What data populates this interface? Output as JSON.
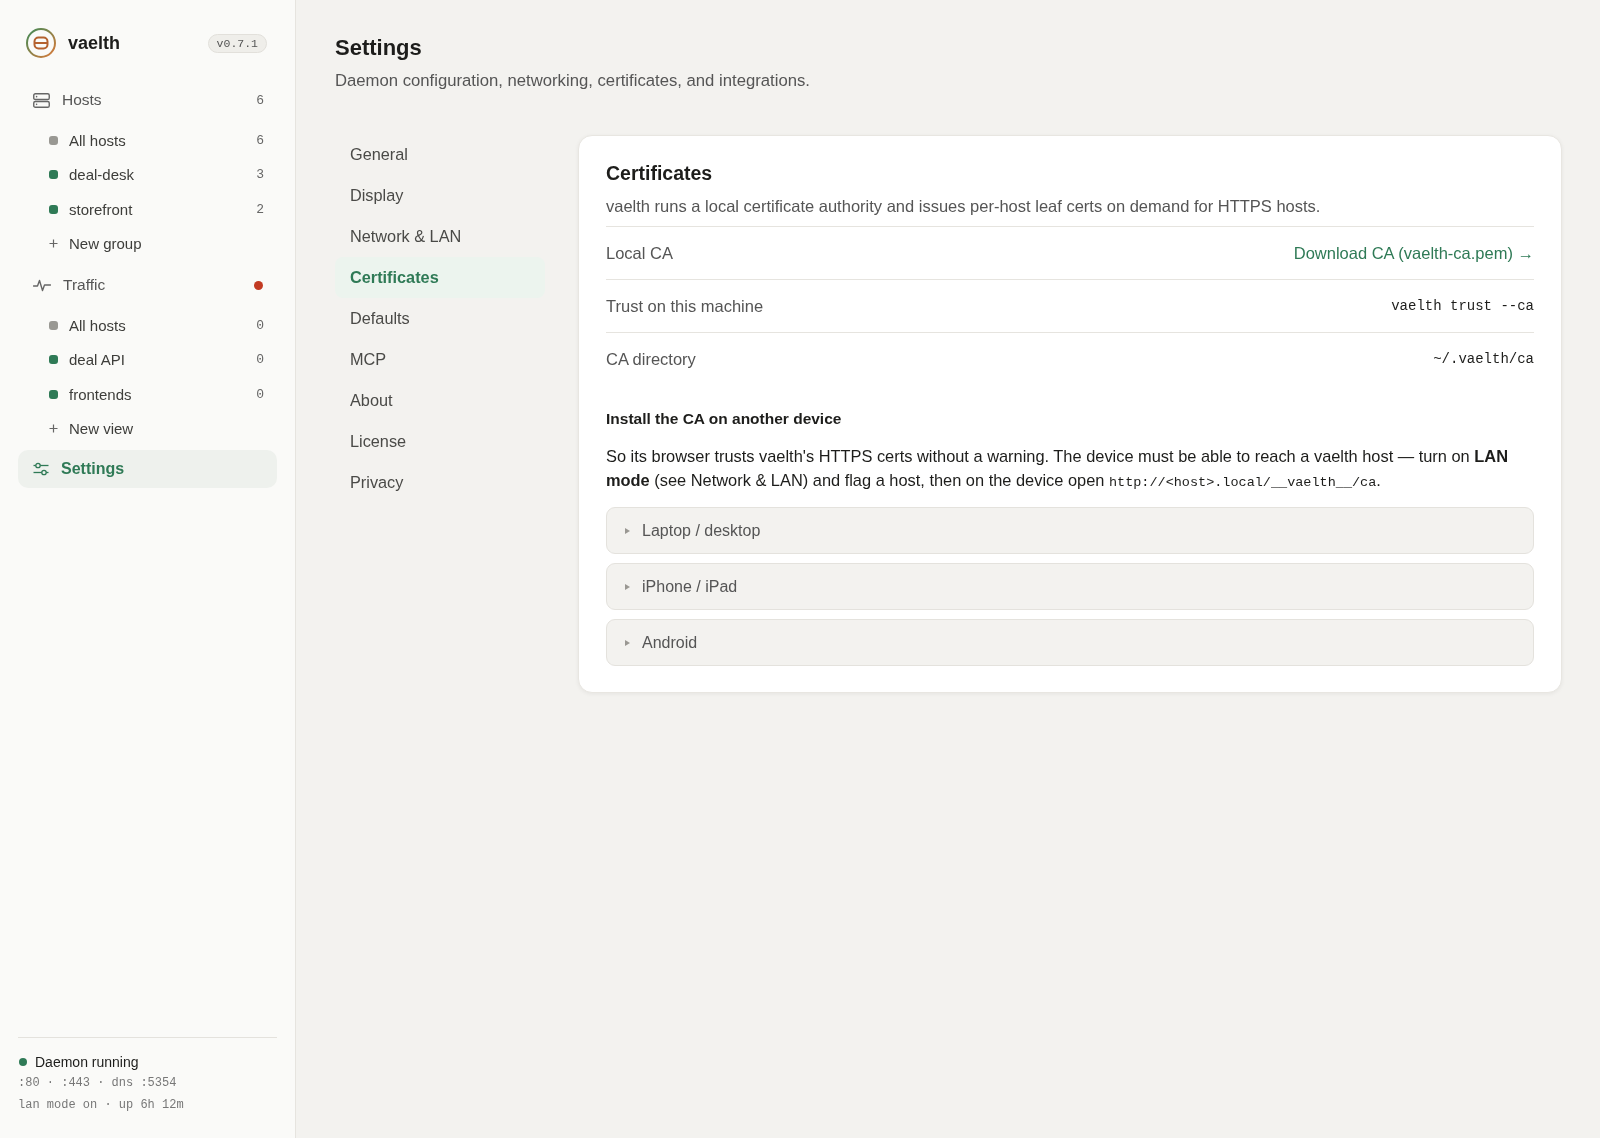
{
  "sidebar": {
    "brand": {
      "name": "vaelth",
      "version": "v0.7.1"
    },
    "sections": [
      {
        "kind": "hosts",
        "label": "Hosts",
        "count": "6",
        "alert": false,
        "selected": false,
        "items": [
          {
            "label": "All hosts",
            "count": "6",
            "color": "#999893",
            "selected": false
          },
          {
            "label": "deal-desk",
            "count": "3",
            "color": "#2f7a56",
            "selected": false
          },
          {
            "label": "storefront",
            "count": "2",
            "color": "#2f7a56",
            "selected": false
          }
        ],
        "add_label": "New group"
      },
      {
        "kind": "traffic",
        "label": "Traffic",
        "alert": true,
        "selected": false,
        "items": [
          {
            "label": "All hosts",
            "count": "0",
            "color": "#999893",
            "selected": false
          },
          {
            "label": "deal API",
            "count": "0",
            "color": "#2f7a56",
            "selected": false
          },
          {
            "label": "frontends",
            "count": "0",
            "color": "#2f7a56",
            "selected": false
          }
        ],
        "add_label": "New view"
      }
    ],
    "settings_link": {
      "label": "Settings",
      "selected": true
    },
    "status": {
      "label": "Daemon running",
      "running": true,
      "ports": ":80 · :443 · dns :5354",
      "details": "lan mode on · up 6h 12m"
    }
  },
  "page": {
    "title": "Settings",
    "subtitle": "Daemon configuration, networking, certificates, and integrations."
  },
  "settings_nav": [
    {
      "label": "General",
      "selected": false
    },
    {
      "label": "Display",
      "selected": false
    },
    {
      "label": "Network & LAN",
      "selected": false
    },
    {
      "label": "Certificates",
      "selected": true
    },
    {
      "label": "Defaults",
      "selected": false
    },
    {
      "label": "MCP",
      "selected": false
    },
    {
      "label": "About",
      "selected": false
    },
    {
      "label": "License",
      "selected": false
    },
    {
      "label": "Privacy",
      "selected": false
    }
  ],
  "card": {
    "title": "Certificates",
    "description": "vaelth runs a local certificate authority and issues per-host leaf certs on demand for HTTPS hosts.",
    "rows": [
      {
        "label": "Local CA",
        "kind": "link",
        "value": "Download CA (vaelth-ca.pem) →"
      },
      {
        "label": "Trust on this machine",
        "kind": "code",
        "value": "vaelth trust --ca"
      },
      {
        "label": "CA directory",
        "kind": "code",
        "value": "~/.vaelth/ca"
      }
    ],
    "install": {
      "heading": "Install the CA on another device",
      "text_before": "So its browser trusts vaelth's HTTPS certs without a warning. The device must be able to reach a vaelth host — turn on **LAN mode** (see Network & LAN) and flag a host, then on the device open ",
      "code": "http://<host>.local/__vaelth__/ca",
      "text_after": ".",
      "platforms": [
        {
          "label": "Laptop / desktop",
          "expanded": false
        },
        {
          "label": "iPhone / iPad",
          "expanded": false
        },
        {
          "label": "Android",
          "expanded": false
        }
      ]
    }
  }
}
